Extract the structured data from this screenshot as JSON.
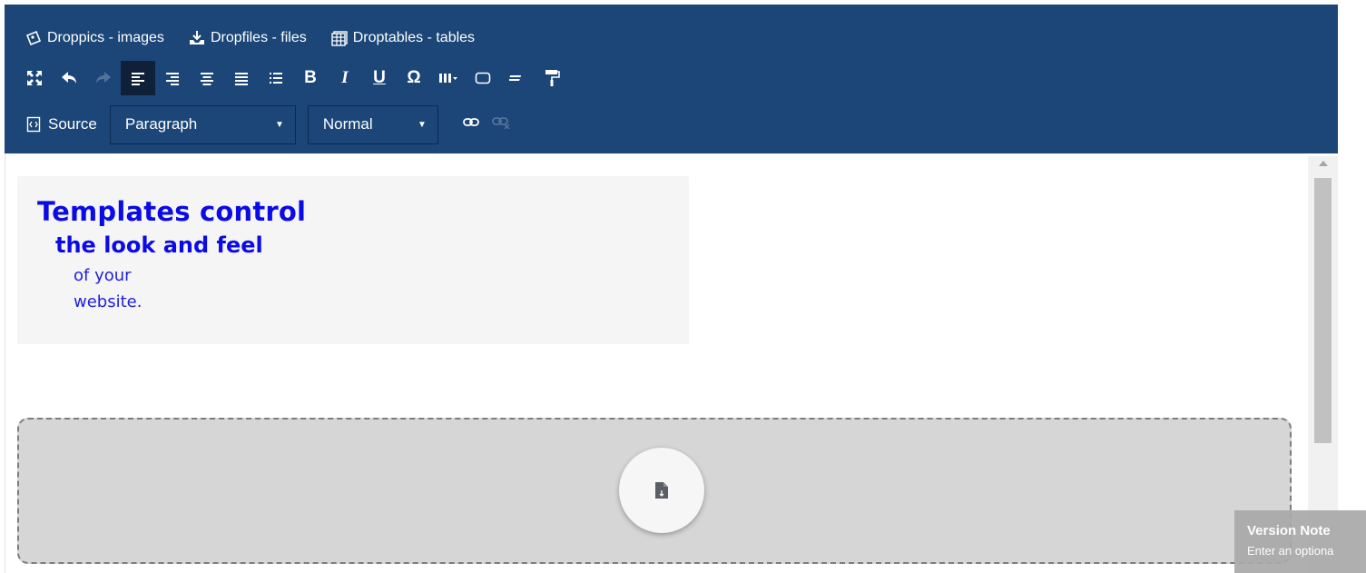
{
  "plugins": [
    {
      "label": "Droppics - images",
      "icon": "droppics-icon"
    },
    {
      "label": "Dropfiles - files",
      "icon": "dropfiles-icon"
    },
    {
      "label": "Droptables - tables",
      "icon": "droptables-icon"
    }
  ],
  "format_toolbar": {
    "maximize_icon": "maximize-icon",
    "undo_icon": "undo-icon",
    "redo_icon": "redo-icon",
    "bold": "B",
    "italic": "I",
    "underline": "U",
    "special_char": "Ω"
  },
  "source_label": "Source",
  "format_select": {
    "value": "Paragraph"
  },
  "style_select": {
    "value": "Normal"
  },
  "template": {
    "line1": "Templates control",
    "line2": "the look and feel",
    "line3": "of your",
    "line4": "website."
  },
  "version_note": {
    "title": "Version Note",
    "subtitle": "Enter an optiona"
  },
  "colors": {
    "toolbar_bg": "#1b4677",
    "template_text": "#0b0be6",
    "dropzone_bg": "#d6d6d6"
  }
}
